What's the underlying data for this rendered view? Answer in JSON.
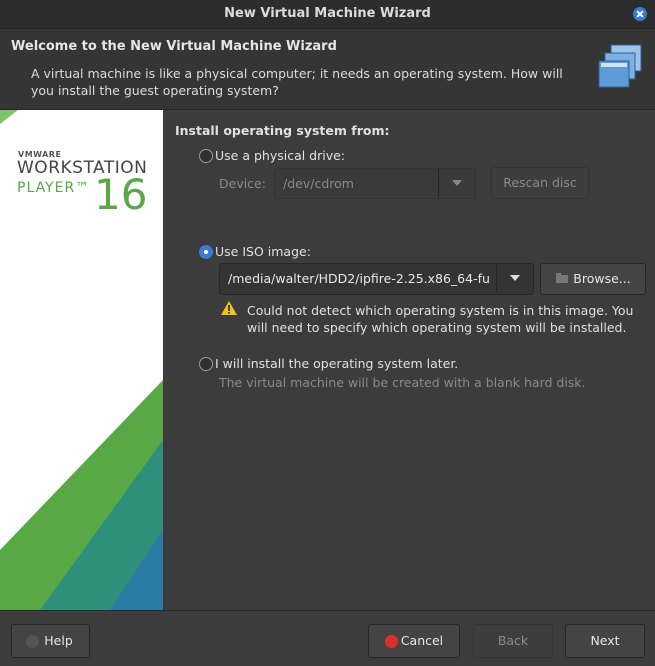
{
  "window": {
    "title": "New Virtual Machine Wizard"
  },
  "header": {
    "title": "Welcome to the New Virtual Machine Wizard",
    "description": "A virtual machine is like a physical computer; it needs an operating system. How will you install the guest operating system?"
  },
  "brand": {
    "vendor": "VMWARE",
    "product": "WORKSTATION",
    "edition": "PLAYER™",
    "version": "16"
  },
  "install": {
    "section_label": "Install operating system from:",
    "physical": {
      "label": "Use a physical drive:",
      "selected": false,
      "device_label": "Device:",
      "device_value": "/dev/cdrom",
      "rescan_label": "Rescan disc"
    },
    "iso": {
      "label": "Use ISO image:",
      "selected": true,
      "path": "/media/walter/HDD2/ipfire-2.25.x86_64-fu",
      "browse_label": "Browse...",
      "warning": "Could not detect which operating system is in this image. You will need to specify which operating system will be installed."
    },
    "later": {
      "label": "I will install the operating system later.",
      "selected": false,
      "note": "The virtual machine will be created with a blank hard disk."
    }
  },
  "footer": {
    "help_label": "Help",
    "cancel_label": "Cancel",
    "back_label": "Back",
    "next_label": "Next"
  },
  "colors": {
    "accent": "#3d7ad6",
    "brand_green": "#58a846",
    "warning": "#f0c020",
    "cancel_red": "#d9302f"
  }
}
